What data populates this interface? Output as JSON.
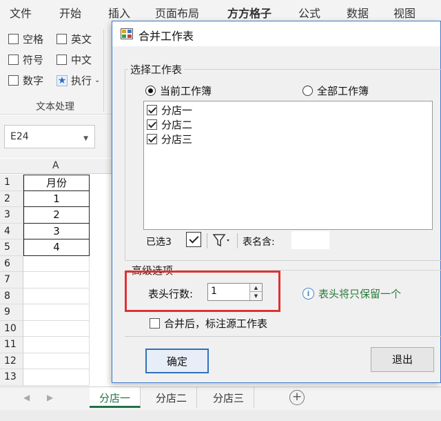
{
  "menu": {
    "items": [
      "文件",
      "开始",
      "插入",
      "页面布局",
      "方方格子",
      "公式",
      "数据",
      "视图"
    ]
  },
  "ribbon": {
    "options": [
      "空格",
      "英文",
      "符号",
      "中文",
      "数字"
    ],
    "execute_label": "执行",
    "group_label": "文本处理"
  },
  "namebox": {
    "value": "E24"
  },
  "grid": {
    "col_a": "A",
    "col_b": "",
    "header_cell": "月份",
    "values": [
      "1",
      "2",
      "3",
      "4"
    ],
    "row_numbers": [
      "1",
      "2",
      "3",
      "4",
      "5",
      "6",
      "7",
      "8",
      "9",
      "10",
      "11",
      "12",
      "13"
    ]
  },
  "sheet_tabs": [
    "分店一",
    "分店二",
    "分店三"
  ],
  "dialog": {
    "title": "合并工作表",
    "select_group_title": "选择工作表",
    "radio_current": "当前工作簿",
    "radio_all": "全部工作簿",
    "sheets": [
      "分店一",
      "分店二",
      "分店三"
    ],
    "selected_count_label": "已选3",
    "sheet_name_label": "表名含:",
    "advanced_title": "高级选项",
    "header_rows_label": "表头行数:",
    "header_rows_value": "1",
    "info_text": "表头将只保留一个",
    "merge_mark_label": "合并后，标注源工作表",
    "ok_label": "确定",
    "exit_label": "退出"
  },
  "colors": {
    "dialog_border": "#3c78c8",
    "highlight_red": "#e03030",
    "info_green": "#2a7a3a",
    "active_tab_green": "#1e7145"
  }
}
